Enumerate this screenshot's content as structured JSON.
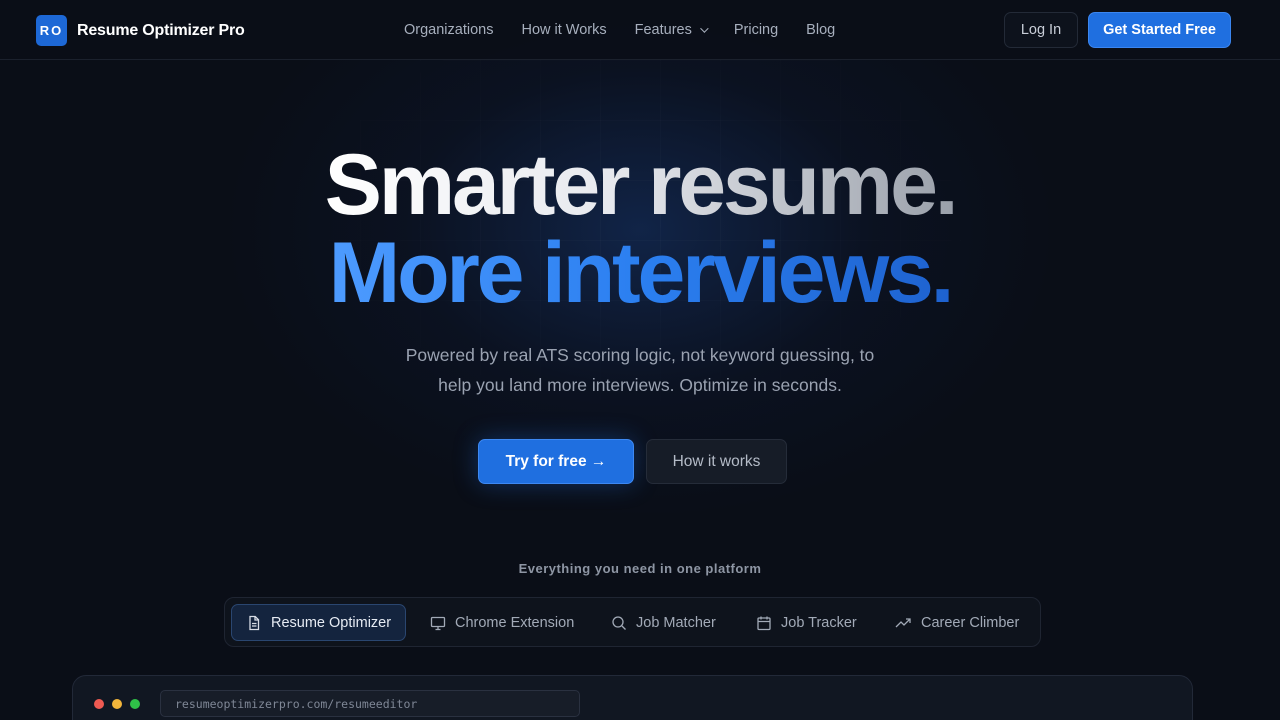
{
  "nav": {
    "logo_mark": "RO",
    "brand": "Resume Optimizer Pro",
    "links": [
      {
        "label": "Organizations"
      },
      {
        "label": "How it Works"
      },
      {
        "label": "Features",
        "has_dropdown": true
      },
      {
        "label": "Pricing"
      },
      {
        "label": "Blog"
      }
    ],
    "login_label": "Log In",
    "cta_label": "Get Started Free"
  },
  "hero": {
    "line1": "Smarter resume.",
    "line2": "More interviews.",
    "subtitle_line1": "Powered by real ATS scoring logic, not keyword guessing, to",
    "subtitle_line2": "help you land more interviews. Optimize in seconds.",
    "primary_cta": "Try for free →",
    "secondary_cta": "How it works"
  },
  "platform": {
    "label": "Everything you need in one platform",
    "tabs": [
      {
        "label": "Resume Optimizer",
        "icon": "document-icon",
        "active": true
      },
      {
        "label": "Chrome Extension",
        "icon": "monitor-icon",
        "active": false
      },
      {
        "label": "Job Matcher",
        "icon": "search-icon",
        "active": false
      },
      {
        "label": "Job Tracker",
        "icon": "calendar-icon",
        "active": false
      },
      {
        "label": "Career Climber",
        "icon": "trending-up-icon",
        "active": false
      }
    ]
  },
  "preview": {
    "url": "resumeoptimizerpro.com/resumeeditor"
  },
  "colors": {
    "background": "#0a0e17",
    "accent": "#1f6fe0",
    "headline_blue": "#3b8cf5"
  }
}
